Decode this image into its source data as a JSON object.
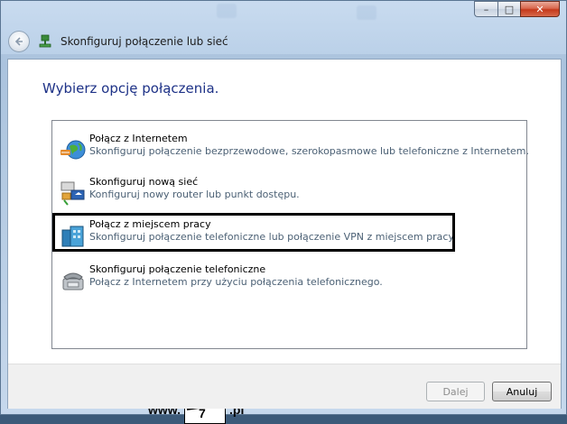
{
  "window": {
    "title": "Skonfiguruj połączenie lub sieć",
    "caption": {
      "minimize": "–",
      "maximize": "□",
      "close": "✕"
    }
  },
  "heading": "Wybierz opcję połączenia.",
  "options": [
    {
      "title": "Połącz z Internetem",
      "description": "Skonfiguruj połączenie bezprzewodowe, szerokopasmowe lub telefoniczne z Internetem.",
      "icon": "globe-network-icon"
    },
    {
      "title": "Skonfiguruj nową sieć",
      "description": "Konfiguruj nowy router lub punkt dostępu.",
      "icon": "router-icon"
    },
    {
      "title": "Połącz z miejscem pracy",
      "description": "Skonfiguruj połączenie telefoniczne lub połączenie VPN z miejscem pracy.",
      "icon": "workplace-icon"
    },
    {
      "title": "Skonfiguruj połączenie telefoniczne",
      "description": "Połącz z Internetem przy użyciu połączenia telefonicznego.",
      "icon": "telephone-modem-icon"
    }
  ],
  "highlighted_option_index": 2,
  "buttons": {
    "next": "Dalej",
    "cancel": "Anuluj"
  },
  "watermark": {
    "prefix": "www.",
    "logo_top": "slow",
    "logo_number": "7",
    "suffix": ".pl"
  },
  "colors": {
    "heading": "#1e3287",
    "description": "#4c6175",
    "accent": "#3c5a79"
  }
}
